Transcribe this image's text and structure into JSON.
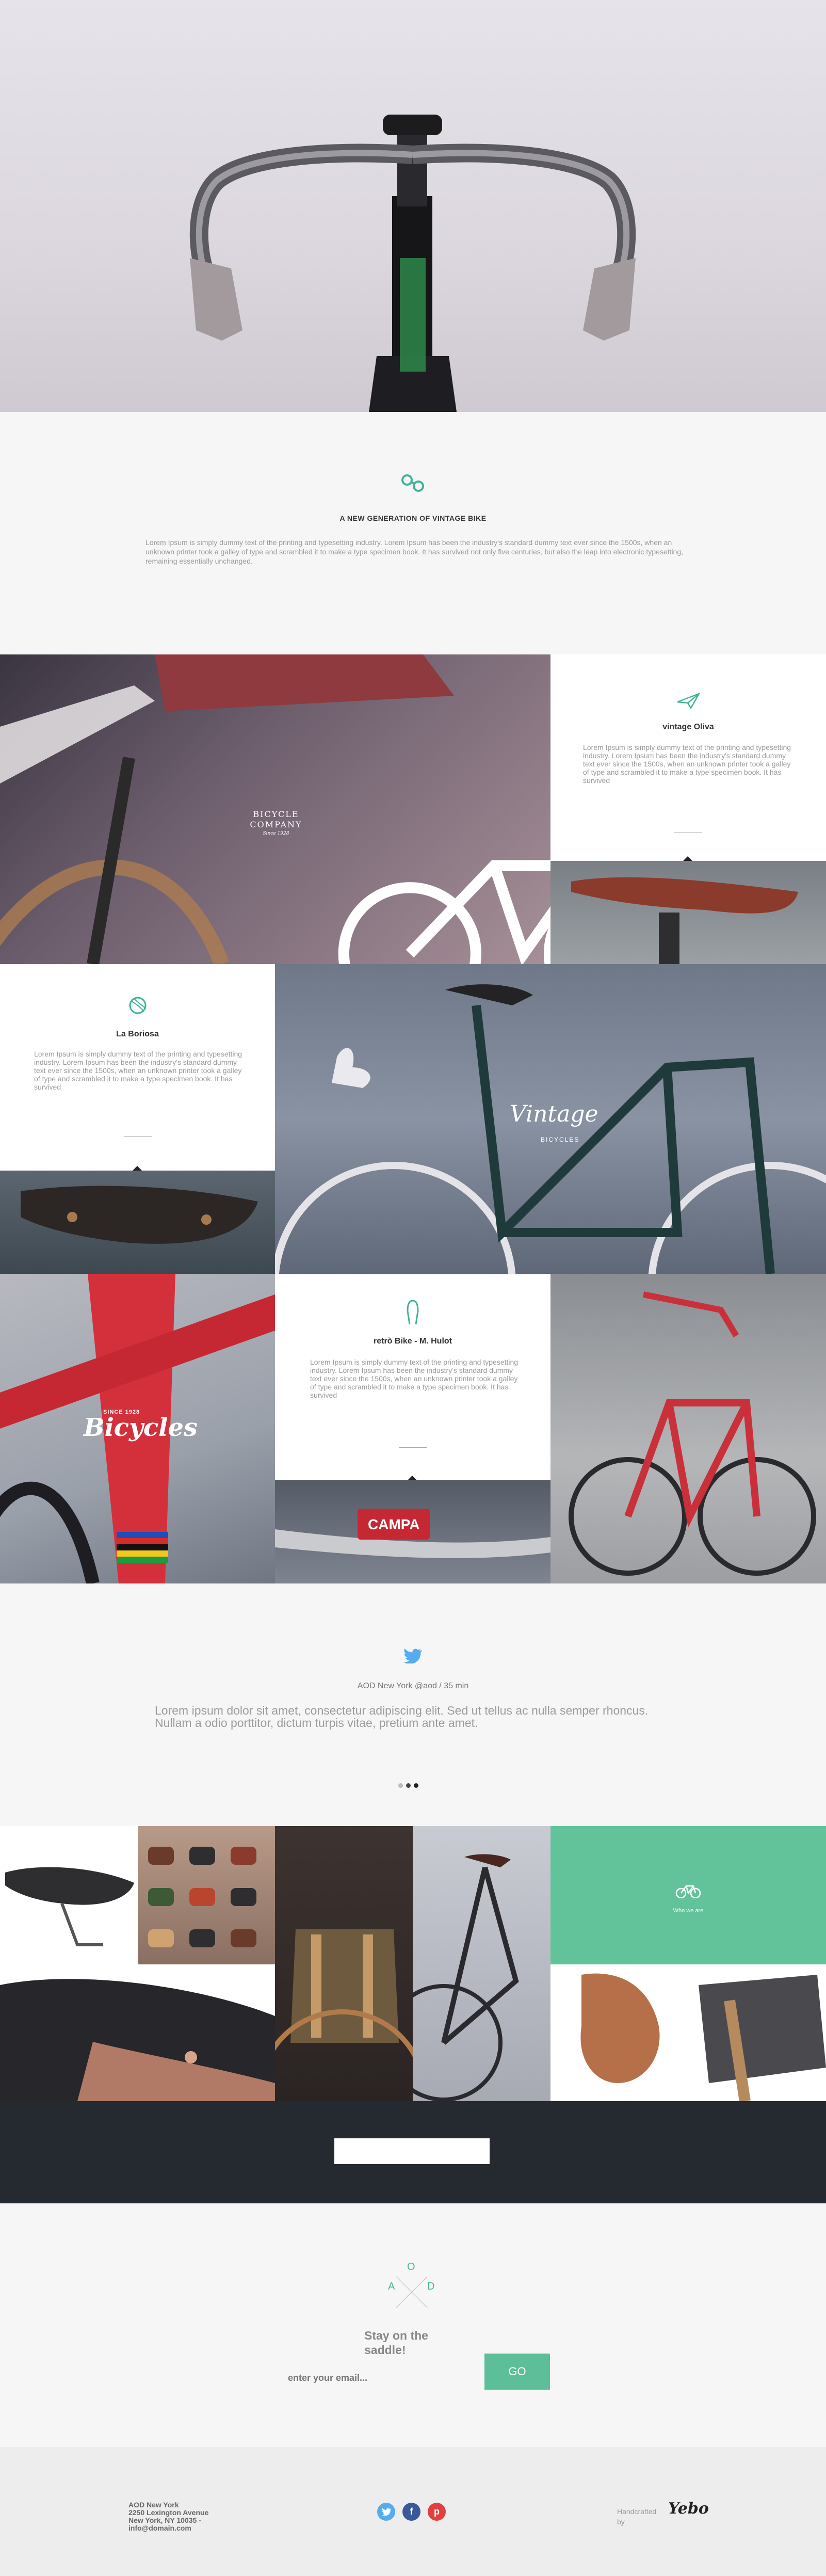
{
  "intro": {
    "title": "A NEW GENERATION OF VINTAGE BIKE",
    "text": "Lorem Ipsum is simply dummy text of the printing and typesetting industry. Lorem Ipsum has been the industry's standard dummy text ever since the 1500s, when an unknown printer took a galley of type and scrambled it to make a type specimen book. It has survived not only five centuries, but also the leap into electronic typesetting, remaining essentially unchanged."
  },
  "grips_photo": {
    "badge_line1": "BICYCLE",
    "badge_line2": "COMPANY",
    "badge_line3": "Since 1928"
  },
  "cards": [
    {
      "title": "vintage Oliva",
      "text": "Lorem Ipsum is simply dummy text of the printing and typesetting industry. Lorem Ipsum has been the industry's standard dummy text ever since the 1500s, when an unknown printer took a galley of type and scrambled it to make a type specimen book. It has survived",
      "icon": "paper-plane-icon"
    },
    {
      "title": "La Boriosa",
      "text": "Lorem Ipsum is simply dummy text of the printing and typesetting industry. Lorem Ipsum has been the industry's standard dummy text ever since the 1500s, when an unknown printer took a galley of type and scrambled it to make a type specimen book. It has survived",
      "icon": "yarn-icon"
    },
    {
      "title": "retrò Bike - M. Hulot",
      "text": "Lorem Ipsum is simply dummy text of the printing and typesetting industry. Lorem Ipsum has been the industry's standard dummy text ever since the 1500s, when an unknown printer took a galley of type and scrambled it to make a type specimen book. It has survived",
      "icon": "tongs-icon"
    }
  ],
  "vintage_photo": {
    "logo": "Vintage",
    "sub": "BICYCLES"
  },
  "bicycles_photo": {
    "logo": "Bicycles",
    "since": "SINCE 1928"
  },
  "rim_photo": {
    "label": "CAMPA"
  },
  "tweet": {
    "meta": "AOD New York @aod / 35 min",
    "text": "Lorem ipsum dolor sit amet, consectetur adipiscing elit. Sed ut tellus ac nulla semper rhoncus. Nullam a odio porttitor, dictum turpis vitae, pretium ante amet."
  },
  "gallery": {
    "teal_caption": "Who we are"
  },
  "newsletter": {
    "logo_a": "A",
    "logo_o": "O",
    "logo_d": "D",
    "heading": "Stay on the saddle!",
    "email_placeholder": "enter your email...",
    "button": "GO"
  },
  "footer": {
    "address_line1": "AOD New York",
    "address_line2": "2250 Lexington Avenue",
    "address_line3": "New York, NY 10035 -",
    "address_line4": "info@domain.com",
    "social": [
      "twitter",
      "facebook",
      "pinterest"
    ],
    "handcrafted_line1": "Handcrafted",
    "handcrafted_line2": "by",
    "brand": "Yebo"
  },
  "colors": {
    "accent": "#3fb497",
    "teal_panel": "#62c39b",
    "dark_band": "#252a30",
    "twitter": "#55acee",
    "facebook": "#3b5998",
    "pinterest": "#e1403f"
  }
}
